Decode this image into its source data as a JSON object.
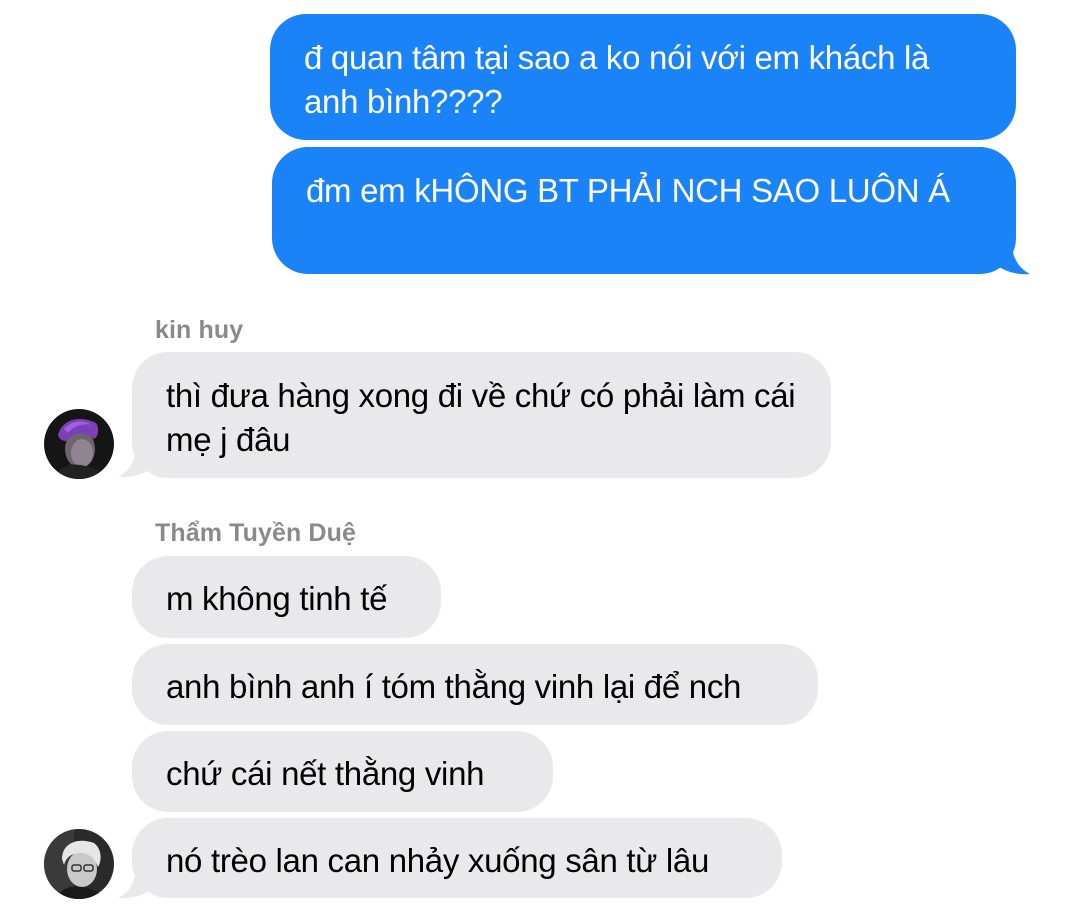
{
  "outgoing": [
    {
      "text": "đ quan tâm tại sao a ko nói với em khách là anh bình????"
    },
    {
      "text": "đm em kHÔNG BT PHẢI NCH SAO LUÔN Á"
    }
  ],
  "groups": [
    {
      "sender": "kin huy",
      "avatar_icon": "profile-photo-purple-hair",
      "messages": [
        {
          "text": "thì đưa hàng xong đi về chứ có phải làm cái mẹ j đâu"
        }
      ]
    },
    {
      "sender": "Thẩm Tuyền Duệ",
      "avatar_icon": "profile-photo-silver-hair",
      "messages": [
        {
          "text": "m không tinh tế"
        },
        {
          "text": "anh bình anh í tóm thằng vinh lại để nch"
        },
        {
          "text": "chứ cái nết thằng vinh"
        },
        {
          "text": "nó trèo lan can nhảy xuống sân từ lâu"
        }
      ]
    }
  ],
  "colors": {
    "outgoing_bubble": "#1a83f8",
    "incoming_bubble": "#e9e9eb",
    "sender_name": "#8a8a8e"
  }
}
